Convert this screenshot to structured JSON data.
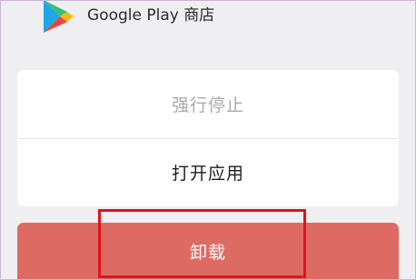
{
  "app": {
    "name": "Google Play 商店",
    "icon": "google-play-icon"
  },
  "actions": {
    "force_stop_label": "强行停止",
    "open_app_label": "打开应用",
    "uninstall_label": "卸载"
  },
  "colors": {
    "uninstall_button": "#de6b63",
    "highlight_box": "#e0141c",
    "disabled_text": "#a9a9ad"
  }
}
